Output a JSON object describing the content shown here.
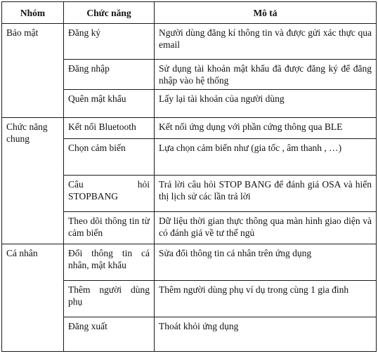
{
  "headers": {
    "group": "Nhóm",
    "function": "Chức năng",
    "description": "Mô tả"
  },
  "groups": [
    {
      "name": "Bảo mật",
      "rows": [
        {
          "function": "Đăng ký",
          "description": "Người dùng đăng kí thông tin và được gửi xác thực qua email"
        },
        {
          "function": "Đăng nhập",
          "description": "Sử dụng tài khoản mật khẩu đã được đăng ký để đăng nhập vào hệ thống"
        },
        {
          "function": "Quên mật khẩu",
          "description": "Lấy lại tài khoản của người dùng"
        }
      ]
    },
    {
      "name": "Chức năng chung",
      "rows": [
        {
          "function": "Kết nối Bluetooth",
          "description": "Kết nối ứng dụng với phần cứng thông qua BLE"
        },
        {
          "function": "Chọn cảm biến",
          "description": "Lựa chọn cảm biến như (gia tốc , âm thanh , …)"
        },
        {
          "function_line1": "Câu hỏi",
          "function_line2": "STOPBANG",
          "description": "Trả lời câu hỏi STOP BANG để đánh giá OSA và hiển thị lịch sử các lần trả lời"
        },
        {
          "function": "Theo dõi thông tin từ cảm biến",
          "description": "Dữ liệu thời gian thực thông qua màn hình giao diện và có đánh giá về tư thế ngủ"
        }
      ]
    },
    {
      "name": "Cá nhân",
      "rows": [
        {
          "function": "Đổi thông tin cá nhân, mật khẩu",
          "description": "Sửa đổi thông tin cá nhân trên ứng dụng"
        },
        {
          "function": "Thêm người dùng phụ",
          "description": "Thêm người dùng phụ ví dụ trong cùng 1 gia đình"
        },
        {
          "function": "Đăng xuất",
          "description": "Thoát khỏi ứng dụng"
        }
      ]
    }
  ]
}
